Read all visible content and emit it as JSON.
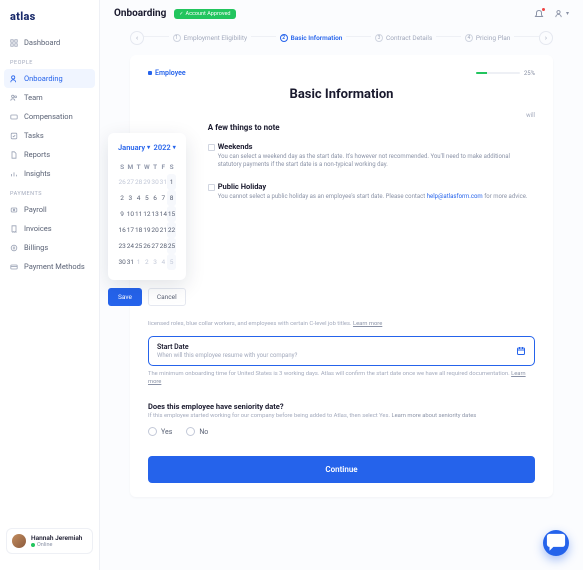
{
  "brand": "atlas",
  "page_title": "Onboarding",
  "account_badge": "Account Approved",
  "nav": {
    "dashboard": "Dashboard",
    "people_label": "PEOPLE",
    "onboarding": "Onboarding",
    "team": "Team",
    "compensation": "Compensation",
    "tasks": "Tasks",
    "reports": "Reports",
    "insights": "Insights",
    "payments_label": "PAYMENTS",
    "payroll": "Payroll",
    "invoices": "Invoices",
    "billings": "Billings",
    "payment_methods": "Payment Methods"
  },
  "user": {
    "name": "Hannah Jeremiah",
    "status": "Online"
  },
  "steps": {
    "s1": "Employment Eligibility",
    "s2": "Basic Information",
    "s3": "Contract Details",
    "s4": "Pricing Plan"
  },
  "progress": {
    "label": "Employee",
    "pct": "25%"
  },
  "heading": "Basic Information",
  "float_txt": "will",
  "calendar": {
    "month": "January",
    "year": "2022",
    "dow": [
      "S",
      "M",
      "T",
      "W",
      "T",
      "F",
      "S"
    ],
    "rows": [
      [
        "26",
        "27",
        "28",
        "29",
        "30",
        "31",
        "1"
      ],
      [
        "2",
        "3",
        "4",
        "5",
        "6",
        "7",
        "8"
      ],
      [
        "9",
        "10",
        "11",
        "12",
        "13",
        "14",
        "15"
      ],
      [
        "16",
        "17",
        "18",
        "19",
        "20",
        "21",
        "22"
      ],
      [
        "23",
        "24",
        "25",
        "26",
        "27",
        "28",
        "25"
      ],
      [
        "30",
        "31",
        "1",
        "2",
        "3",
        "4",
        "5"
      ]
    ],
    "selected": "18",
    "save": "Save",
    "cancel": "Cancel"
  },
  "notes": {
    "title": "A few things to note",
    "n1": {
      "h": "Weekends",
      "p": "You can select a weekend day as the start date. It's however not recommended. You'll need to make additional statutory payments if the start date is a non-typical working day."
    },
    "n2": {
      "h": "Public Holiday",
      "p": "You cannot select a public holiday as an employee's start date. Please contact ",
      "link": "help@atlasform.com",
      "tail": " for more advice."
    }
  },
  "hint": {
    "text": "licensed roles, blue collar workers, and employees with certain C-level job titles. ",
    "link": "Learn more"
  },
  "start_date": {
    "label": "Start Date",
    "sub": "When will this employee resume with your company?"
  },
  "helper": {
    "text": "The minimum onboarding time for United States is 3 working days. Atlas will confirm the start date once we have all required documentation. ",
    "link": "Learn more"
  },
  "seniority": {
    "q": "Does this employee have seniority date?",
    "sub_a": "If this employee started working for our company before being added to Atlas, then select Yes. ",
    "sub_link": "Learn more about seniority dates",
    "yes": "Yes",
    "no": "No"
  },
  "continue": "Continue"
}
